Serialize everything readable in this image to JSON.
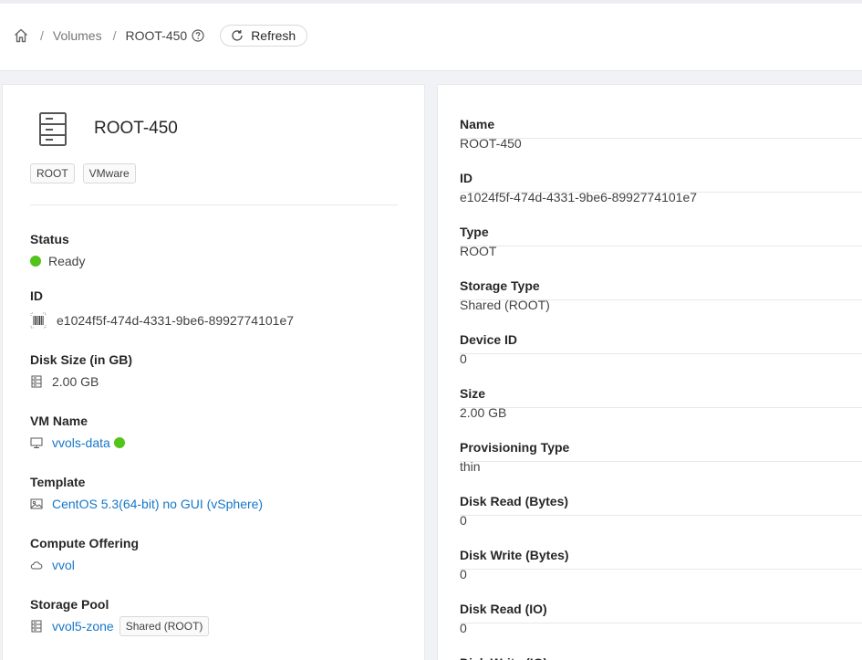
{
  "breadcrumb": {
    "home_icon": "home-icon",
    "separator": "/",
    "parent": "Volumes",
    "current": "ROOT-450",
    "help_icon": "question-circle-icon",
    "refresh_label": "Refresh",
    "refresh_icon": "reload-icon"
  },
  "summary": {
    "icon": "server-storage-icon",
    "title": "ROOT-450",
    "tags": [
      "ROOT",
      "VMware"
    ],
    "fields": {
      "status": {
        "label": "Status",
        "value": "Ready",
        "status_color": "#52c41a"
      },
      "id": {
        "label": "ID",
        "value": "e1024f5f-474d-4331-9be6-8992774101e7",
        "icon": "barcode-icon"
      },
      "disk_size": {
        "label": "Disk Size (in GB)",
        "value": "2.00 GB",
        "icon": "database-icon"
      },
      "vm_name": {
        "label": "VM Name",
        "value": "vvols-data",
        "icon": "desktop-icon",
        "status_color": "#52c41a"
      },
      "template": {
        "label": "Template",
        "value": "CentOS 5.3(64-bit) no GUI (vSphere)",
        "icon": "picture-icon"
      },
      "compute_offering": {
        "label": "Compute Offering",
        "value": "vvol",
        "icon": "cloud-icon"
      },
      "storage_pool": {
        "label": "Storage Pool",
        "value": "vvol5-zone",
        "tag": "Shared (ROOT)",
        "icon": "database-icon"
      }
    }
  },
  "details": [
    {
      "key": "Name",
      "value": "ROOT-450"
    },
    {
      "key": "ID",
      "value": "e1024f5f-474d-4331-9be6-8992774101e7"
    },
    {
      "key": "Type",
      "value": "ROOT"
    },
    {
      "key": "Storage Type",
      "value": "Shared (ROOT)"
    },
    {
      "key": "Device ID",
      "value": "0"
    },
    {
      "key": "Size",
      "value": "2.00 GB"
    },
    {
      "key": "Provisioning Type",
      "value": "thin"
    },
    {
      "key": "Disk Read (Bytes)",
      "value": "0"
    },
    {
      "key": "Disk Write (Bytes)",
      "value": "0"
    },
    {
      "key": "Disk Read (IO)",
      "value": "0"
    },
    {
      "key": "Disk Write (IO)",
      "value": ""
    }
  ],
  "colors": {
    "link": "#1677c9",
    "status_ok": "#52c41a"
  }
}
